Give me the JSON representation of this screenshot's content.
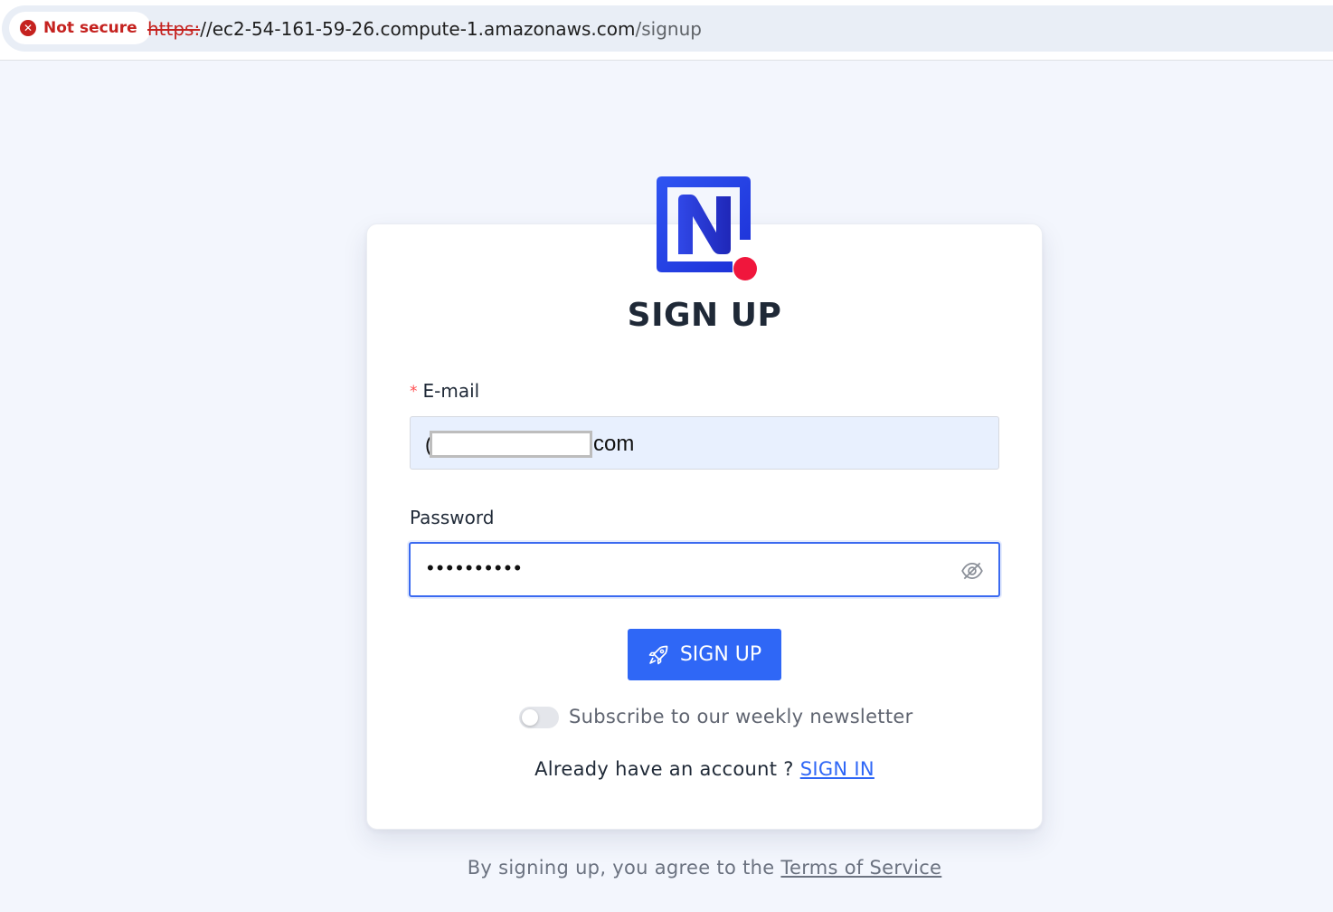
{
  "browser": {
    "security_label": "Not secure",
    "url_scheme": "https:",
    "url_host": "//ec2-54-161-59-26.compute-1.amazonaws.com",
    "url_path": "/signup"
  },
  "page": {
    "title": "SIGN UP",
    "email": {
      "required_marker": "*",
      "label": "E-mail",
      "value_prefix": "(",
      "value_suffix": "com"
    },
    "password": {
      "label": "Password",
      "masked_value": "••••••••••"
    },
    "signup_button_label": "SIGN UP",
    "newsletter": {
      "label": "Subscribe to our weekly newsletter",
      "enabled": false
    },
    "already_text": "Already have an account ? ",
    "signin_link": "SIGN IN",
    "terms_text": "By signing up, you agree to the ",
    "terms_link": "Terms of Service"
  },
  "colors": {
    "brand_blue": "#2f67f6",
    "logo_dot": "#f0163c",
    "not_secure_red": "#c5221f"
  }
}
